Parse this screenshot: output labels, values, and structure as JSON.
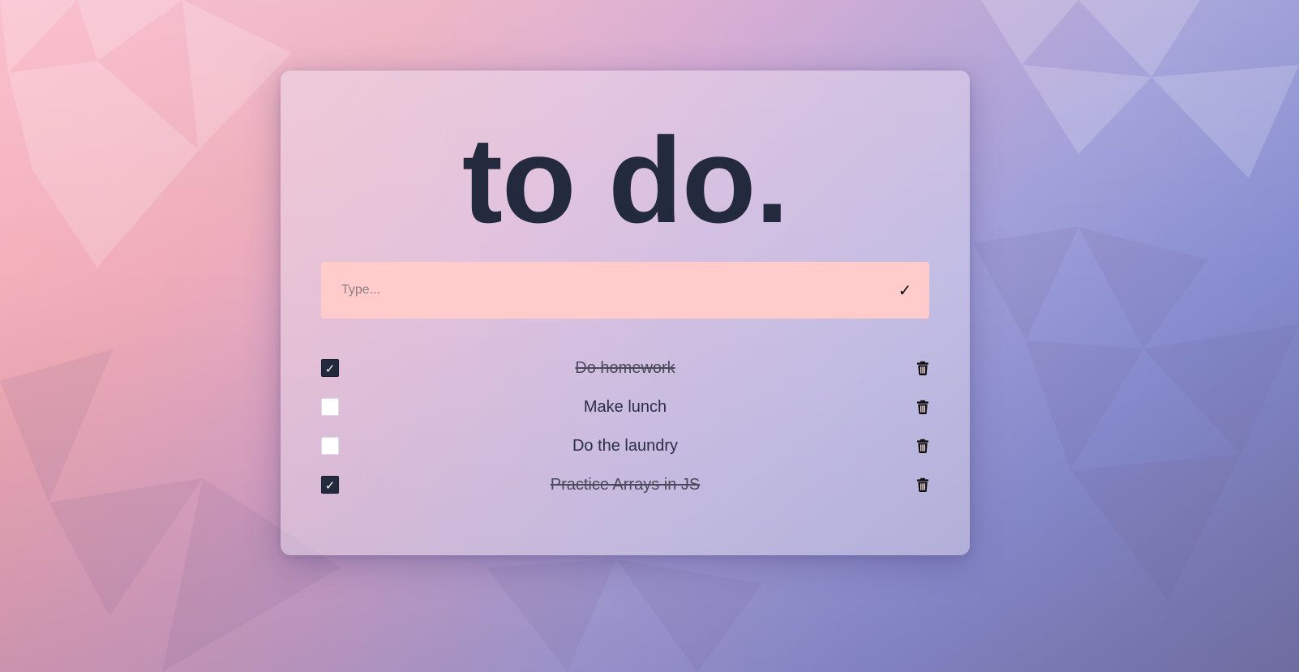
{
  "app": {
    "title": "to do."
  },
  "input": {
    "placeholder": "Type...",
    "value": "",
    "submit_label": "✓"
  },
  "todos": [
    {
      "text": "Do homework",
      "done": true
    },
    {
      "text": "Make lunch",
      "done": false
    },
    {
      "text": "Do the laundry",
      "done": false
    },
    {
      "text": "Practice Arrays in JS",
      "done": true
    }
  ],
  "icons": {
    "checked": "✓",
    "trash": "trash-icon"
  },
  "colors": {
    "title": "#232a3d",
    "input_bg": "#ffcccb",
    "checkbox_checked": "#232a3d",
    "checkbox_unchecked": "#ffffff"
  }
}
